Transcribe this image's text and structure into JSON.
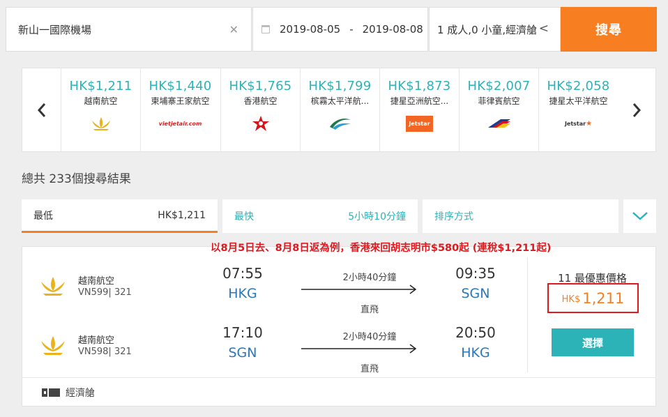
{
  "search": {
    "origin": "新山一國際機場",
    "depart_date": "2019-08-05",
    "date_separator": "-",
    "return_date": "2019-08-08",
    "passengers": "1 成人,0 小童,經濟艙",
    "search_label": "搜尋"
  },
  "carousel": {
    "items": [
      {
        "price": "HK$1,211",
        "name": "越南航空"
      },
      {
        "price": "HK$1,440",
        "name": "柬埔寨王家航空",
        "logo_text": "vietjetair.com"
      },
      {
        "price": "HK$1,765",
        "name": "香港航空"
      },
      {
        "price": "HK$1,799",
        "name": "槟霧太平洋航..."
      },
      {
        "price": "HK$1,873",
        "name": "捷星亞洲航空...",
        "logo_text": "Jetstar"
      },
      {
        "price": "HK$2,007",
        "name": "菲律賓航空"
      },
      {
        "price": "HK$2,058",
        "name": "捷星太平洋航空",
        "logo_text": "Jetstar"
      }
    ]
  },
  "results": {
    "count_text": "總共 233個搜尋結果"
  },
  "sort": {
    "cheapest_label": "最低",
    "cheapest_value": "HK$1,211",
    "fastest_label": "最快",
    "fastest_value": "5小時10分鐘",
    "order_label": "排序方式"
  },
  "promo_text": "以8月5日去、8月8日返為例，香港來回胡志明市$580起 (連稅$1,211起)",
  "flight": {
    "legs": [
      {
        "airline": "越南航空",
        "code": "VN599| 321",
        "dep_time": "07:55",
        "dep_airport": "HKG",
        "duration": "2小時40分鐘",
        "stops": "直飛",
        "arr_time": "09:35",
        "arr_airport": "SGN"
      },
      {
        "airline": "越南航空",
        "code": "VN598| 321",
        "dep_time": "17:10",
        "dep_airport": "SGN",
        "duration": "2小時40分鐘",
        "stops": "直飛",
        "arr_time": "20:50",
        "arr_airport": "HKG"
      }
    ],
    "best_label": "11 最優惠價格",
    "currency": "HK$",
    "price": "1,211",
    "select_label": "選擇",
    "cabin": "經濟艙"
  },
  "colors": {
    "accent_orange": "#f77f22",
    "teal": "#2bb3b7",
    "promo_red": "#e0191f",
    "airport_blue": "#2a78b8"
  }
}
